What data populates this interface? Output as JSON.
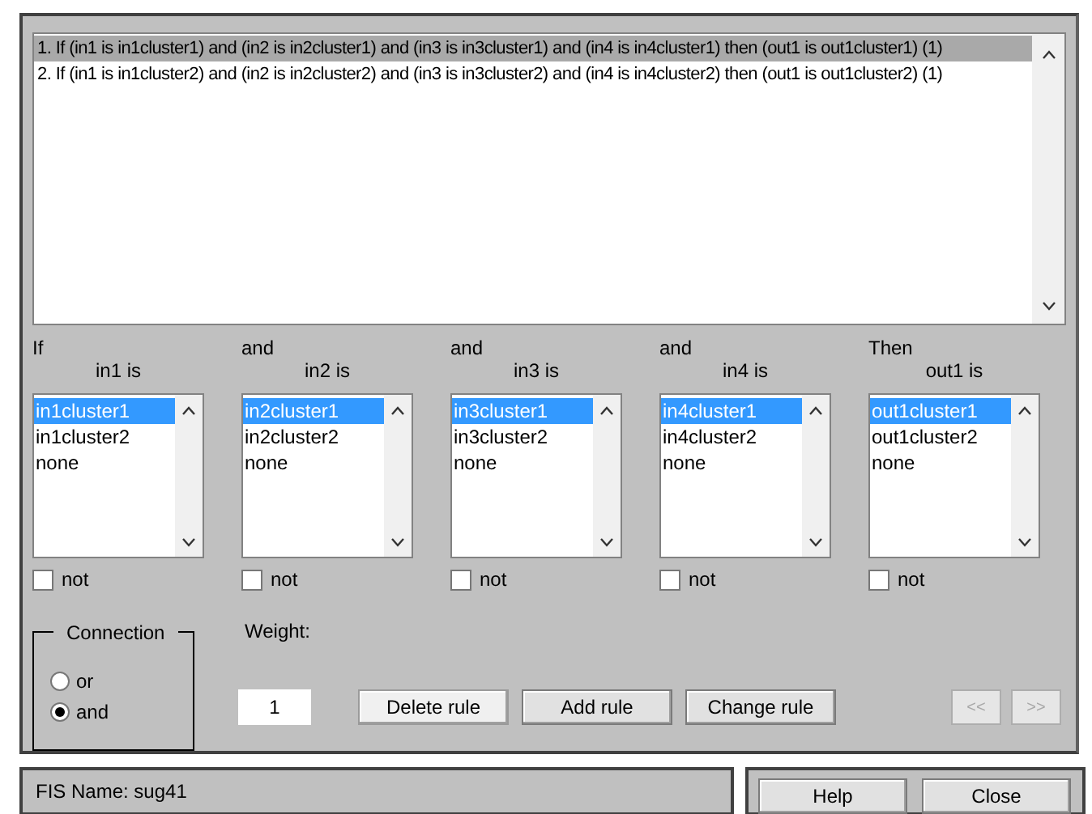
{
  "rules": [
    {
      "text": "1. If (in1 is in1cluster1) and (in2 is in2cluster1) and (in3 is in3cluster1) and (in4 is in4cluster1) then (out1 is out1cluster1) (1)",
      "selected": true
    },
    {
      "text": "2. If (in1 is in1cluster2) and (in2 is in2cluster2) and (in3 is in3cluster2) and (in4 is in4cluster2) then (out1 is out1cluster2) (1)",
      "selected": false
    }
  ],
  "variables": [
    {
      "connector": "If",
      "label": "in1 is",
      "options": [
        {
          "text": "in1cluster1",
          "selected": true
        },
        {
          "text": "in1cluster2",
          "selected": false
        },
        {
          "text": "none",
          "selected": false
        }
      ],
      "not": {
        "label": "not",
        "checked": false
      }
    },
    {
      "connector": "and",
      "label": "in2 is",
      "options": [
        {
          "text": "in2cluster1",
          "selected": true
        },
        {
          "text": "in2cluster2",
          "selected": false
        },
        {
          "text": "none",
          "selected": false
        }
      ],
      "not": {
        "label": "not",
        "checked": false
      }
    },
    {
      "connector": "and",
      "label": "in3 is",
      "options": [
        {
          "text": "in3cluster1",
          "selected": true
        },
        {
          "text": "in3cluster2",
          "selected": false
        },
        {
          "text": "none",
          "selected": false
        }
      ],
      "not": {
        "label": "not",
        "checked": false
      }
    },
    {
      "connector": "and",
      "label": "in4 is",
      "options": [
        {
          "text": "in4cluster1",
          "selected": true
        },
        {
          "text": "in4cluster2",
          "selected": false
        },
        {
          "text": "none",
          "selected": false
        }
      ],
      "not": {
        "label": "not",
        "checked": false
      }
    },
    {
      "connector": "Then",
      "label": "out1 is",
      "options": [
        {
          "text": "out1cluster1",
          "selected": true
        },
        {
          "text": "out1cluster2",
          "selected": false
        },
        {
          "text": "none",
          "selected": false
        }
      ],
      "not": {
        "label": "not",
        "checked": false
      }
    }
  ],
  "connection": {
    "title": "Connection",
    "options": [
      {
        "label": "or",
        "selected": false
      },
      {
        "label": "and",
        "selected": true
      }
    ]
  },
  "weight": {
    "label": "Weight:",
    "value": "1"
  },
  "rule_buttons": [
    {
      "label": "Delete rule",
      "disabled": false,
      "focused": true
    },
    {
      "label": "Add rule",
      "disabled": false,
      "focused": false
    },
    {
      "label": "Change rule",
      "disabled": false,
      "focused": false
    }
  ],
  "nav_buttons": [
    {
      "label": "<<",
      "disabled": true
    },
    {
      "label": ">>",
      "disabled": true
    }
  ],
  "status_bar": {
    "text": "FIS Name: sug41"
  },
  "footer_buttons": [
    {
      "label": "Help",
      "disabled": false
    },
    {
      "label": "Close",
      "disabled": false
    }
  ]
}
